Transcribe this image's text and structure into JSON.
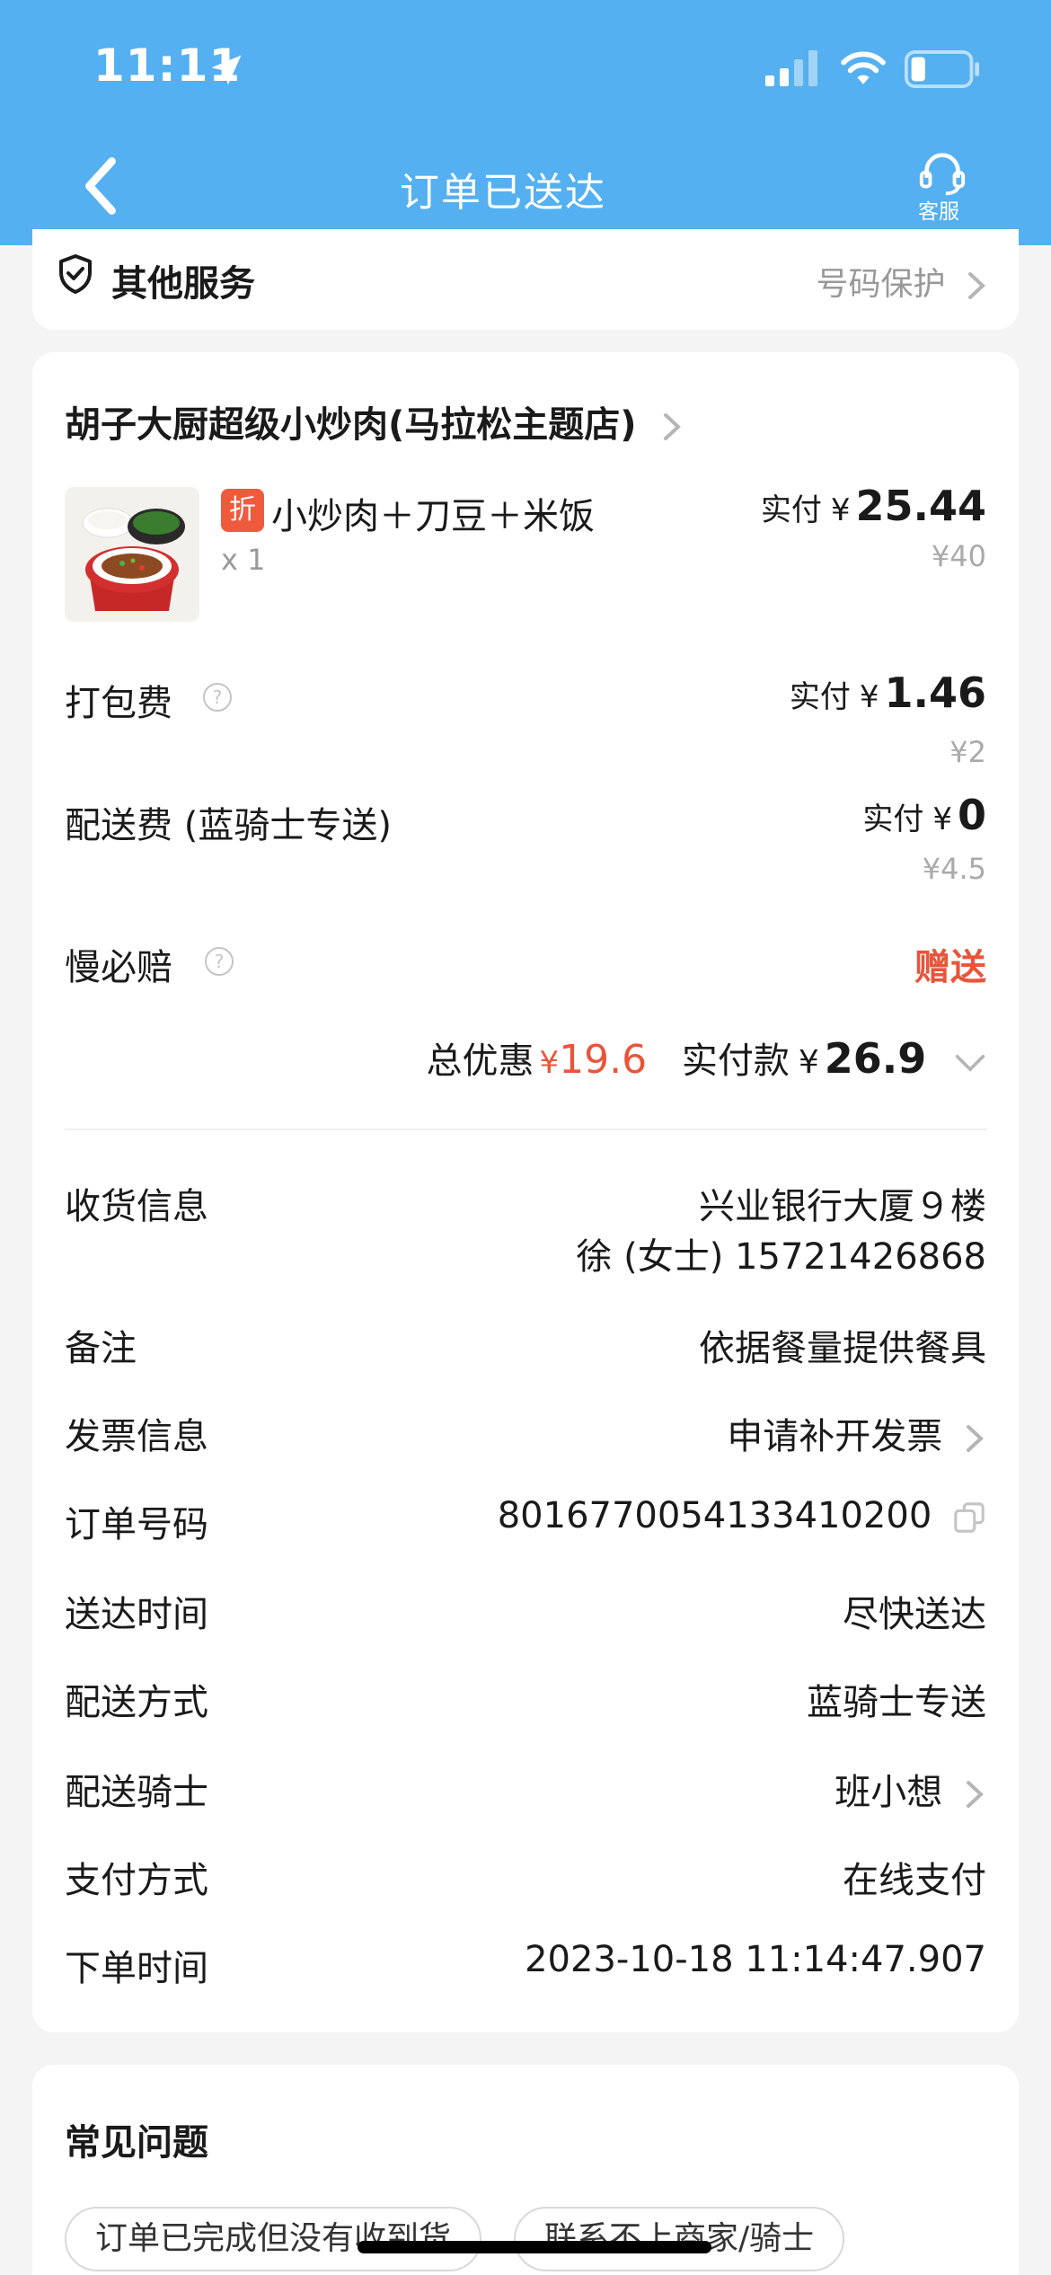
{
  "status_bar": {
    "time": "11:11"
  },
  "nav": {
    "title": "订单已送达",
    "service_label": "客服"
  },
  "other_services": {
    "title": "其他服务",
    "value": "号码保护"
  },
  "shop": {
    "name": "胡子大厨超级小炒肉(马拉松主题店)"
  },
  "item": {
    "badge": "折",
    "name": "小炒肉＋刀豆＋米饭",
    "qty": "x 1",
    "paid_label": "实付",
    "currency": "¥",
    "paid": "25.44",
    "original": "¥40"
  },
  "fees": [
    {
      "label": "打包费",
      "paid_label": "实付",
      "currency": "¥",
      "paid": "1.46",
      "original": "¥2"
    },
    {
      "label": "配送费 (蓝骑士专送)",
      "paid_label": "实付",
      "currency": "¥",
      "paid": "0",
      "original": "¥4.5"
    }
  ],
  "slow_compensation": {
    "label": "慢必赔",
    "value": "赠送"
  },
  "summary": {
    "discount_label": "总优惠",
    "discount_currency": "¥",
    "discount": "19.6",
    "paid_label": "实付款",
    "paid_currency": "¥",
    "paid": "26.9"
  },
  "info": {
    "address": {
      "label": "收货信息",
      "line1": "兴业银行大厦９楼",
      "line2": "徐 (女士) 15721426868"
    },
    "remark": {
      "label": "备注",
      "value": "依据餐量提供餐具"
    },
    "invoice": {
      "label": "发票信息",
      "value": "申请补开发票"
    },
    "order_no": {
      "label": "订单号码",
      "value": "8016770054133410200"
    },
    "delivery_time": {
      "label": "送达时间",
      "value": "尽快送达"
    },
    "delivery_method": {
      "label": "配送方式",
      "value": "蓝骑士专送"
    },
    "rider": {
      "label": "配送骑士",
      "value": "班小想"
    },
    "payment": {
      "label": "支付方式",
      "value": "在线支付"
    },
    "order_time": {
      "label": "下单时间",
      "value": "2023-10-18 11:14:47.907"
    }
  },
  "faq": {
    "title": "常见问题",
    "chips": [
      "订单已完成但没有收到货",
      "联系不上商家/骑士"
    ]
  },
  "colors": {
    "header": "#54b0f0",
    "accent_red": "#e8553a"
  }
}
